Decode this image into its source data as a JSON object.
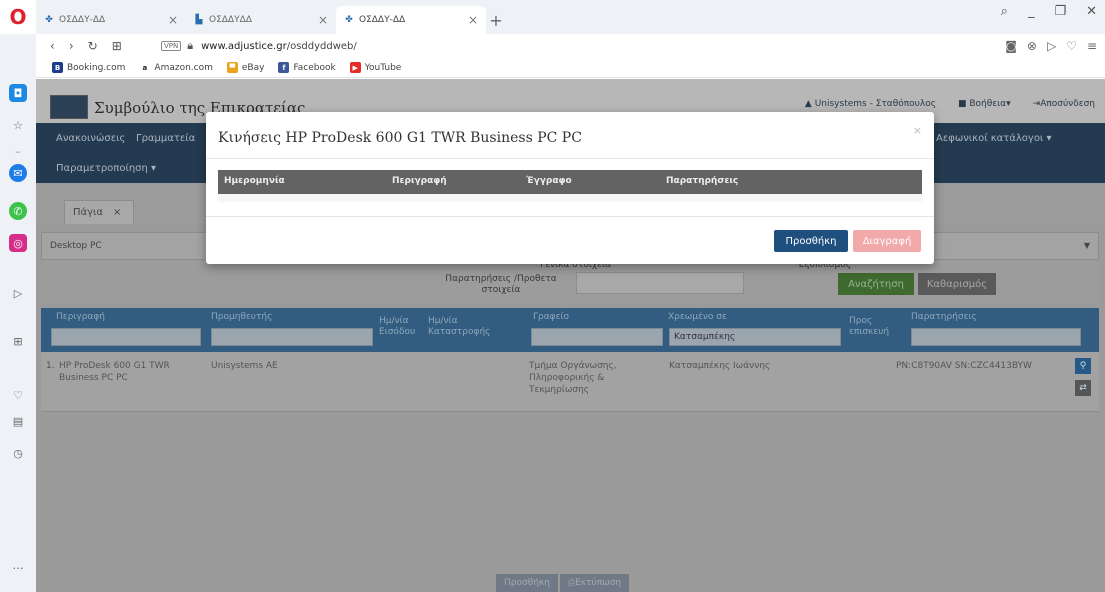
{
  "browser": {
    "tabs": [
      {
        "title": "ΟΣΔΔΥ-ΔΔ",
        "active": false
      },
      {
        "title": "ΟΣΔΔΥΔΔ",
        "active": false
      },
      {
        "title": "ΟΣΔΔΥ-ΔΔ",
        "active": true
      }
    ],
    "url_host": "www.adjustice.gr",
    "url_path": "/osddyddweb/",
    "vpn": "VPN",
    "bookmarks": [
      "Booking.com",
      "Amazon.com",
      "eBay",
      "Facebook",
      "YouTube"
    ]
  },
  "site": {
    "title": "Συμβούλιο της Επικρατείας",
    "user": "Unisystems - Σταθόπουλος",
    "help": "Βοήθεια",
    "logout": "Αποσύνδεση",
    "menu": [
      "Ανακοινώσεις",
      "Γραμματεία",
      "Αεφωνικοί κατάλογοι",
      "Παραμετροποίηση"
    ],
    "page_tab": "Πάγια",
    "category": "Desktop PC",
    "filter_label_1": "Γενικά στοιχεία",
    "filter_label_2": "Εξοπλισμός",
    "filter_label_3": "Παρατηρήσεις /Προθετα στοιχεία",
    "search_button": "Αναζήτηση",
    "clear_button": "Καθαρισμός"
  },
  "table": {
    "headers": [
      "Περιγραφή",
      "Προμηθευτής",
      "Ημ/νία Εισόδου",
      "Ημ/νία Καταστροφής",
      "Γραφείο",
      "Χρεωμένο σε",
      "Προς επισκευή",
      "Παρατηρήσεις"
    ],
    "chreomeno_filter": "Κατσαμπέκης",
    "rows": [
      {
        "num": "1.",
        "description": "HP ProDesk 600 G1 TWR Business PC PC",
        "supplier": "Unisystems AE",
        "office": "Τμήμα Οργάνωσης, Πληροφορικής & Τεκμηρίωσης",
        "assigned": "Κατσαμπέκης Ιωάννης",
        "notes": "PN:C8T90AV SN:CZC4413BYW"
      }
    ],
    "bottom_buttons": [
      "Προσθήκη",
      "Εκτύπωση"
    ]
  },
  "modal": {
    "title": "Κινήσεις HP ProDesk 600 G1 TWR Business PC PC",
    "close": "×",
    "columns": [
      "Ημερομηνία",
      "Περιγραφή",
      "Έγγραφο",
      "Παρατηρήσεις"
    ],
    "add_button": "Προσθήκη",
    "delete_button": "Διαγραφή"
  }
}
